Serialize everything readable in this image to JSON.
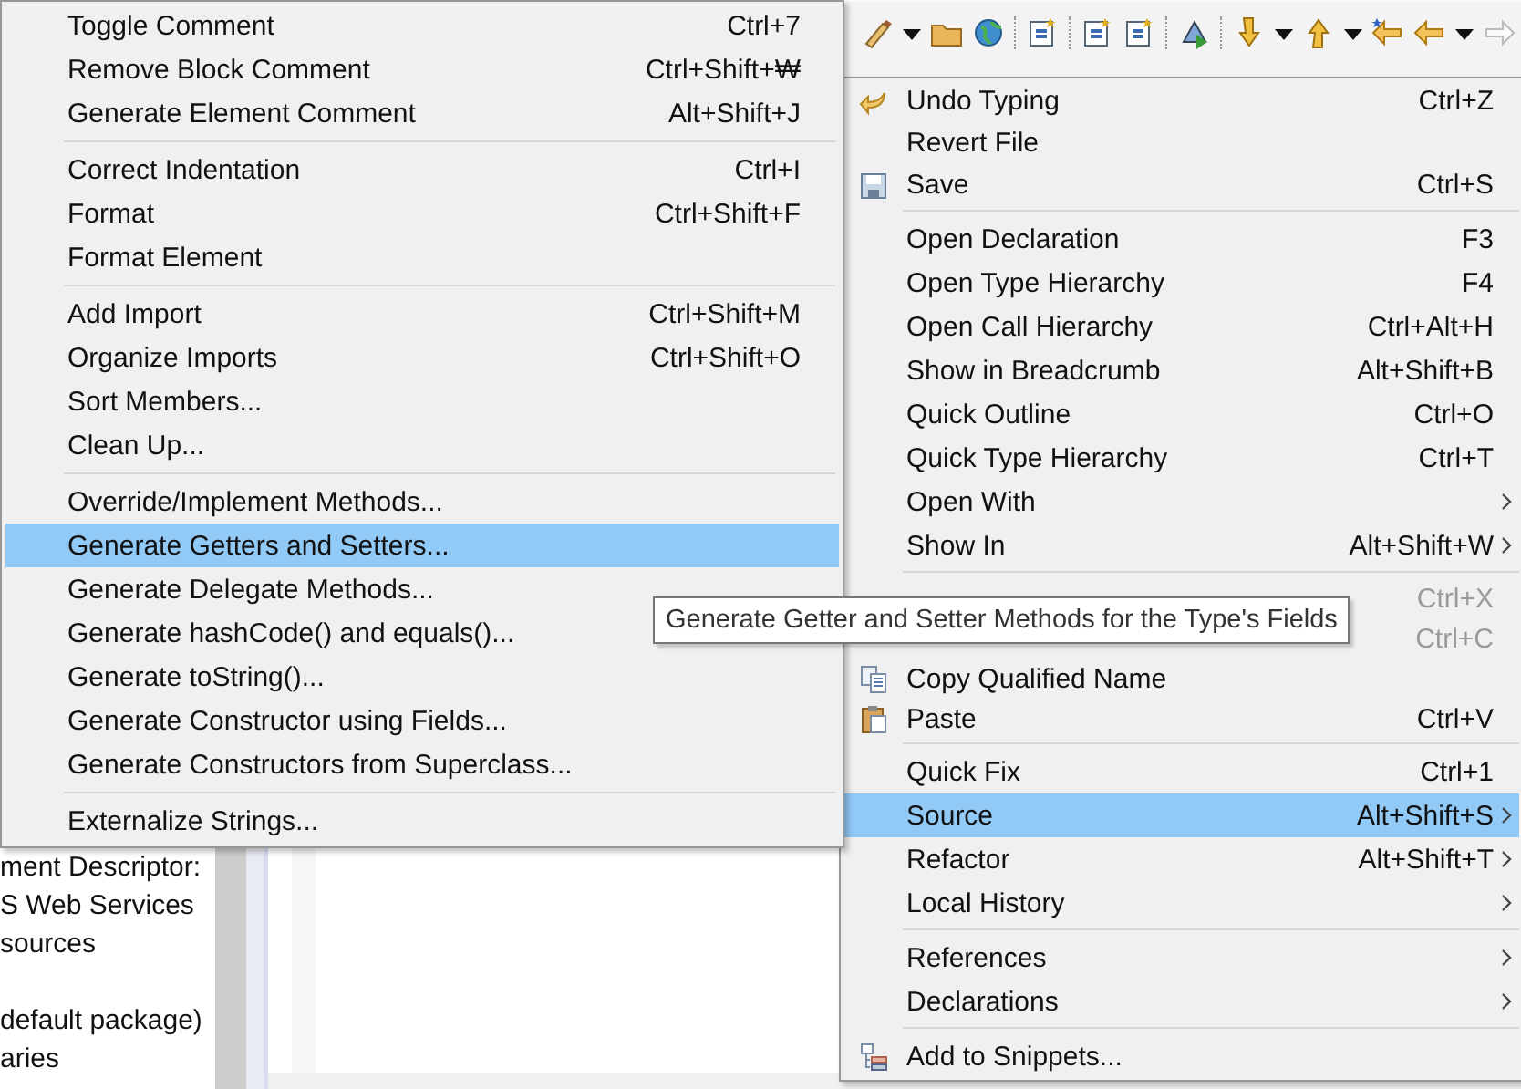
{
  "package_explorer": {
    "items": [
      {
        "label": "ment Descriptor:"
      },
      {
        "label": "S Web Services"
      },
      {
        "label": "sources"
      },
      {
        "label": "default package)"
      },
      {
        "label": "aries"
      }
    ]
  },
  "source_submenu": {
    "groups": [
      [
        {
          "label": "Toggle Comment",
          "shortcut": "Ctrl+7",
          "selected": false
        },
        {
          "label": "Remove Block Comment",
          "shortcut": "Ctrl+Shift+₩",
          "selected": false
        },
        {
          "label": "Generate Element Comment",
          "shortcut": "Alt+Shift+J",
          "selected": false
        }
      ],
      [
        {
          "label": "Correct Indentation",
          "shortcut": "Ctrl+I",
          "selected": false
        },
        {
          "label": "Format",
          "shortcut": "Ctrl+Shift+F",
          "selected": false
        },
        {
          "label": "Format Element",
          "selected": false
        }
      ],
      [
        {
          "label": "Add Import",
          "shortcut": "Ctrl+Shift+M",
          "selected": false
        },
        {
          "label": "Organize Imports",
          "shortcut": "Ctrl+Shift+O",
          "selected": false
        },
        {
          "label": "Sort Members...",
          "selected": false
        },
        {
          "label": "Clean Up...",
          "selected": false
        }
      ],
      [
        {
          "label": "Override/Implement Methods...",
          "selected": false
        },
        {
          "label": "Generate Getters and Setters...",
          "selected": true
        },
        {
          "label": "Generate Delegate Methods...",
          "selected": false
        },
        {
          "label": "Generate hashCode() and equals()...",
          "selected": false
        },
        {
          "label": "Generate toString()...",
          "selected": false
        },
        {
          "label": "Generate Constructor using Fields...",
          "selected": false
        },
        {
          "label": "Generate Constructors from Superclass...",
          "selected": false
        }
      ],
      [
        {
          "label": "Externalize Strings...",
          "selected": false
        }
      ]
    ]
  },
  "context_menu": {
    "groups": [
      [
        {
          "label": "Undo Typing",
          "shortcut": "Ctrl+Z",
          "selected": false,
          "disabled": false,
          "submenu": false
        },
        {
          "label": "Revert File",
          "selected": false,
          "disabled": false,
          "submenu": false
        },
        {
          "label": "Save",
          "shortcut": "Ctrl+S",
          "selected": false,
          "disabled": false,
          "submenu": false
        }
      ],
      [
        {
          "label": "Open Declaration",
          "shortcut": "F3",
          "selected": false,
          "disabled": false,
          "submenu": false
        },
        {
          "label": "Open Type Hierarchy",
          "shortcut": "F4",
          "selected": false,
          "disabled": false,
          "submenu": false
        },
        {
          "label": "Open Call Hierarchy",
          "shortcut": "Ctrl+Alt+H",
          "selected": false,
          "disabled": false,
          "submenu": false
        },
        {
          "label": "Show in Breadcrumb",
          "shortcut": "Alt+Shift+B",
          "selected": false,
          "disabled": false,
          "submenu": false
        },
        {
          "label": "Quick Outline",
          "shortcut": "Ctrl+O",
          "selected": false,
          "disabled": false,
          "submenu": false
        },
        {
          "label": "Quick Type Hierarchy",
          "shortcut": "Ctrl+T",
          "selected": false,
          "disabled": false,
          "submenu": false
        },
        {
          "label": "Open With",
          "selected": false,
          "disabled": false,
          "submenu": true
        },
        {
          "label": "Show In",
          "shortcut": "Alt+Shift+W",
          "selected": false,
          "disabled": false,
          "submenu": true
        }
      ],
      [
        {
          "shortcut": "Ctrl+X",
          "selected": false,
          "disabled": true,
          "submenu": false
        },
        {
          "shortcut": "Ctrl+C",
          "selected": false,
          "disabled": true,
          "submenu": false
        },
        {
          "label": "Copy Qualified Name",
          "selected": false,
          "disabled": false,
          "submenu": false
        },
        {
          "label": "Paste",
          "shortcut": "Ctrl+V",
          "selected": false,
          "disabled": false,
          "submenu": false
        }
      ],
      [
        {
          "label": "Quick Fix",
          "shortcut": "Ctrl+1",
          "selected": false,
          "disabled": false,
          "submenu": false
        },
        {
          "label": "Source",
          "shortcut": "Alt+Shift+S",
          "selected": true,
          "disabled": false,
          "submenu": true
        },
        {
          "label": "Refactor",
          "shortcut": "Alt+Shift+T",
          "selected": false,
          "disabled": false,
          "submenu": true
        },
        {
          "label": "Local History",
          "selected": false,
          "disabled": false,
          "submenu": true
        }
      ],
      [
        {
          "label": "References",
          "selected": false,
          "disabled": false,
          "submenu": true
        },
        {
          "label": "Declarations",
          "selected": false,
          "disabled": false,
          "submenu": true
        }
      ],
      [
        {
          "label": "Add to Snippets...",
          "selected": false,
          "disabled": false,
          "submenu": false
        }
      ]
    ]
  },
  "tooltip": {
    "text": "Generate Getter and Setter Methods for the Type's Fields"
  }
}
